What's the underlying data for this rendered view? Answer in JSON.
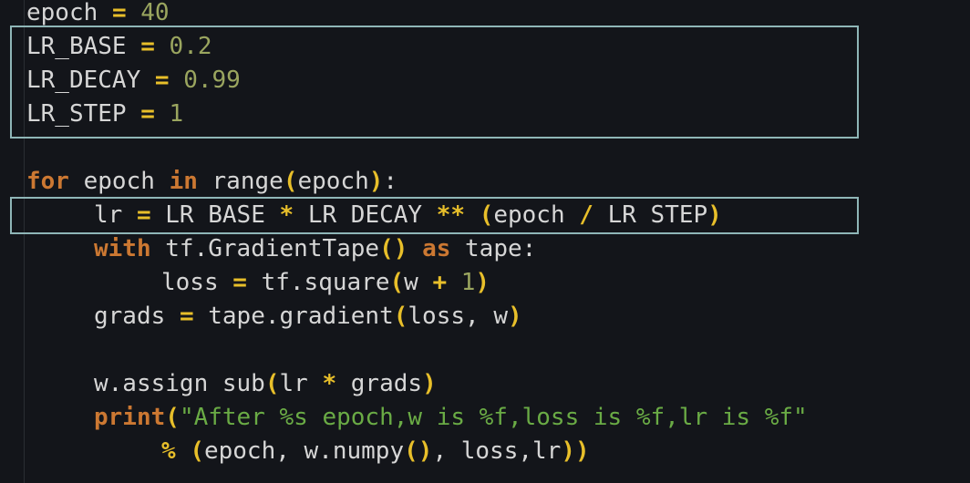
{
  "code": {
    "l1": {
      "name": "epoch",
      "eq": "=",
      "value": "40"
    },
    "l2": {
      "name": "LR_BASE",
      "eq": "=",
      "value": "0.2"
    },
    "l3": {
      "name": "LR_DECAY",
      "eq": "=",
      "value": "0.99"
    },
    "l4": {
      "name": "LR_STEP",
      "eq": "=",
      "value": "1"
    },
    "l5": {
      "kw_for": "for",
      "var": "epoch",
      "kw_in": "in",
      "fn": "range",
      "lp": "(",
      "arg": "epoch",
      "rp": ")",
      "colon": ":"
    },
    "l6": {
      "lr": "lr",
      "eq": "=",
      "a": "LR BASE",
      "mul": "*",
      "b": "LR DECAY",
      "pow": "**",
      "lp": "(",
      "c": "epoch",
      "div": "/",
      "d": "LR STEP",
      "rp": ")"
    },
    "l7": {
      "kw_with": "with",
      "call": "tf.GradientTape",
      "parens": "()",
      "kw_as": "as",
      "name": "tape",
      "colon": ":"
    },
    "l8": {
      "loss": "loss",
      "eq": "=",
      "call": "tf.square",
      "lp": "(",
      "w": "w",
      "plus": "+",
      "num": "1",
      "rp": ")"
    },
    "l9": {
      "grads": "grads",
      "eq": "=",
      "call": "tape.gradient",
      "lp": "(",
      "args": "loss, w",
      "rp": ")"
    },
    "l10": {
      "call": "w.assign sub",
      "lp": "(",
      "lr": "lr",
      "mul": "*",
      "grads": "grads",
      "rp": ")"
    },
    "l11": {
      "kw_print": "print",
      "lp": "(",
      "str": "\"After %s epoch,w is %f,loss is %f,lr is %f\""
    },
    "l12": {
      "mod": "%",
      "lp": "(",
      "a": "epoch, w.numpy",
      "parens": "()",
      "b": ", loss,lr",
      "rp": "))"
    }
  },
  "colors": {
    "background": "#13151a",
    "keyword": "#cc7832",
    "number": "#9aa55f",
    "operator": "#e8bf2a",
    "string": "#6aab45",
    "highlight_border": "#8fb6b7"
  }
}
